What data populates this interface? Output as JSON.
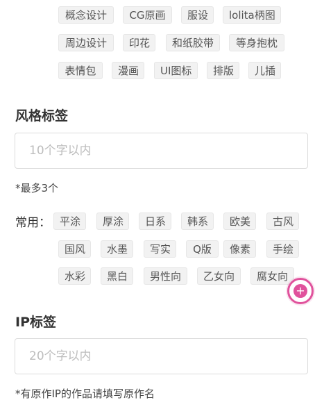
{
  "category_tags": {
    "row1": [
      "概念设计",
      "CG原画",
      "服设",
      "lolita柄图"
    ],
    "row2": [
      "周边设计",
      "印花",
      "和纸胶带",
      "等身抱枕"
    ],
    "row3": [
      "表情包",
      "漫画",
      "UI图标",
      "排版",
      "儿插"
    ]
  },
  "style_section": {
    "title": "风格标签",
    "input_placeholder": "10个字以内",
    "hint": "*最多3个",
    "common_label": "常用：",
    "common_tags_row1": [
      "平涂",
      "厚涂",
      "日系",
      "韩系",
      "欧美",
      "古风"
    ],
    "common_tags_row2": [
      "国风",
      "水墨",
      "写实",
      "Q版",
      "像素",
      "手绘"
    ],
    "common_tags_row3": [
      "水彩",
      "黑白",
      "男性向",
      "乙女向",
      "腐女向"
    ]
  },
  "ip_section": {
    "title": "IP标签",
    "input_placeholder": "20个字以内",
    "hint": "*有原作IP的作品请填写原作名"
  },
  "fab": {
    "icon": "plus-icon",
    "glyph": "+",
    "accent_color": "#e0529c"
  }
}
